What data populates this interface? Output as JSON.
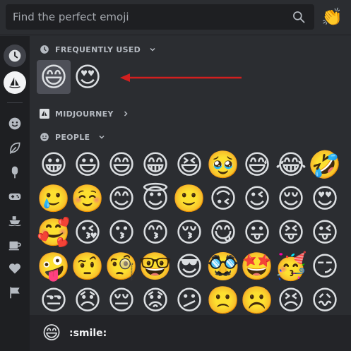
{
  "search": {
    "placeholder": "Find the perfect emoji",
    "value": ""
  },
  "emoji_button": {
    "emoji": "👏"
  },
  "sidebar": {
    "categories": [
      {
        "name": "frequently-used",
        "icon": "clock-icon",
        "active": true
      },
      {
        "name": "midjourney",
        "icon": "midjourney-sailboat-icon"
      },
      {
        "name": "people",
        "icon": "smiley-icon"
      },
      {
        "name": "nature",
        "icon": "leaf-icon"
      },
      {
        "name": "food",
        "icon": "popsicle-icon"
      },
      {
        "name": "activities",
        "icon": "gamepad-icon"
      },
      {
        "name": "travel",
        "icon": "boat-icon"
      },
      {
        "name": "objects",
        "icon": "coffee-icon"
      },
      {
        "name": "symbols",
        "icon": "heart-icon"
      },
      {
        "name": "flags",
        "icon": "flag-icon"
      }
    ]
  },
  "sections": {
    "frequently_used": {
      "label": "FREQUENTLY USED",
      "emojis": [
        "😄",
        "😍"
      ]
    },
    "midjourney": {
      "label": "MIDJOURNEY"
    },
    "people": {
      "label": "PEOPLE",
      "emojis": [
        "😀",
        "😃",
        "😄",
        "😁",
        "😆",
        "🥹",
        "😅",
        "😂",
        "🤣",
        "🥲",
        "☺️",
        "😊",
        "😇",
        "🙂",
        "🙃",
        "😉",
        "😌",
        "😍",
        "🥰",
        "😘",
        "😗",
        "😙",
        "😚",
        "😋",
        "😛",
        "😝",
        "😜",
        "🤪",
        "🤨",
        "🧐",
        "🤓",
        "😎",
        "🥸",
        "🤩",
        "🥳",
        "😏",
        "😒",
        "😞",
        "😔",
        "😟",
        "😕",
        "🙁",
        "☹️",
        "😣",
        "😖"
      ]
    }
  },
  "footer": {
    "emoji": "😄",
    "name": ":smile:"
  },
  "colors": {
    "accent_arrow": "#d21f1f",
    "hover": "#4e5058"
  }
}
